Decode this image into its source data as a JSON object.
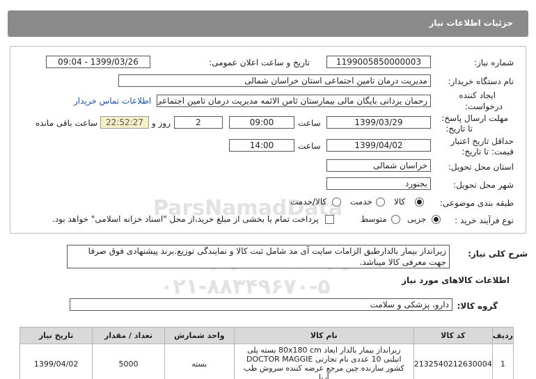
{
  "header": {
    "title": "جزئیات اطلاعات نیاز"
  },
  "form": {
    "need_number_label": "شماره نیاز:",
    "need_number": "1199005850000003",
    "announce_label": "تاریخ و ساعت اعلان عمومی:",
    "announce_value": "1399/03/26 - 09:04",
    "buyer_label": "نام دستگاه خریدار:",
    "buyer_value": "مدیریت درمان تامین اجتماعی استان خراسان شمالی",
    "creator_label_1": "ایجاد کننده",
    "creator_label_2": "درخواست:",
    "creator_value": "رحمان یزدانی بایگان مالی بیمارستان ثامن الائمه مدیریت درمان تامین اجتماعی استان خراسان شمالی",
    "contact_link": "اطلاعات تماس خریدار",
    "send_deadline_label_1": "مهلت ارسال پاسخ:",
    "send_deadline_label_2": "تا تاریخ:",
    "send_date": "1399/03/29",
    "time_label": "ساعت",
    "send_time": "09:00",
    "days_value": "2",
    "days_label": "روز و",
    "remaining_value": "22:52:27",
    "remaining_label": "ساعت باقی مانده",
    "validity_label_1": "حداقل تاریخ اعتبار",
    "validity_label_2": "قیمت: تا تاریخ:",
    "validity_date": "1399/04/02",
    "validity_time_label": "ساعت",
    "validity_time": "14:00",
    "province_label": "استان محل تحویل:",
    "province_value": "خراسان شمالی",
    "city_label": "شهر محل تحویل:",
    "city_value": "بجنورد",
    "category_label": "طبقه بندی موضوعی:",
    "category_options": [
      "کالا",
      "خدمت",
      "کالا/خدمت"
    ],
    "process_label": "نوع فرآیند خرید :",
    "process_options": [
      "جزیی",
      "متوسط"
    ],
    "payment_note": "پرداخت تمام یا بخشی از مبلغ خرید،از محل \"اسناد خزانه اسلامی\" خواهد بود."
  },
  "watermark": {
    "brand": "ParsNamadData",
    "line1": "پایگاه اطلاع رسانی مناقصه و مزایده",
    "phone": "۰۲۱-۸۸۳۴۹۶۷۰-۵"
  },
  "description": {
    "label": "شرح کلی نیاز:",
    "text": "زیرانداز بیمار بالدارطبق الزامات سایت آی مد شامل ثبت کالا و نمایندگی توزیع.برند پیشنهادی فوق صرفا جهت معرفی کالا میباشد."
  },
  "goods": {
    "section_title": "اطلاعات کالاهای مورد نیاز",
    "group_label": "گروه کالا:",
    "group_value": "دارو، پزشکی و سلامت"
  },
  "table": {
    "headers": [
      "ردیف",
      "کد کالا",
      "نام کالا",
      "واحد شمارش",
      "تعداد / مقدار",
      "تاریخ نیاز"
    ],
    "rows": [
      {
        "row": "1",
        "code": "2132540212630004",
        "name": "زیرانداز بیمار بالدار ابعاد 80x180 cm بسته پلی اتیلنی 10 عددی نام تجارتی DOCTOR MAGGIE کشور سازنده چین مرجع عرضه کننده سروش طب آریا",
        "unit": "بسته",
        "qty": "5000",
        "date": "1399/04/02"
      }
    ]
  }
}
